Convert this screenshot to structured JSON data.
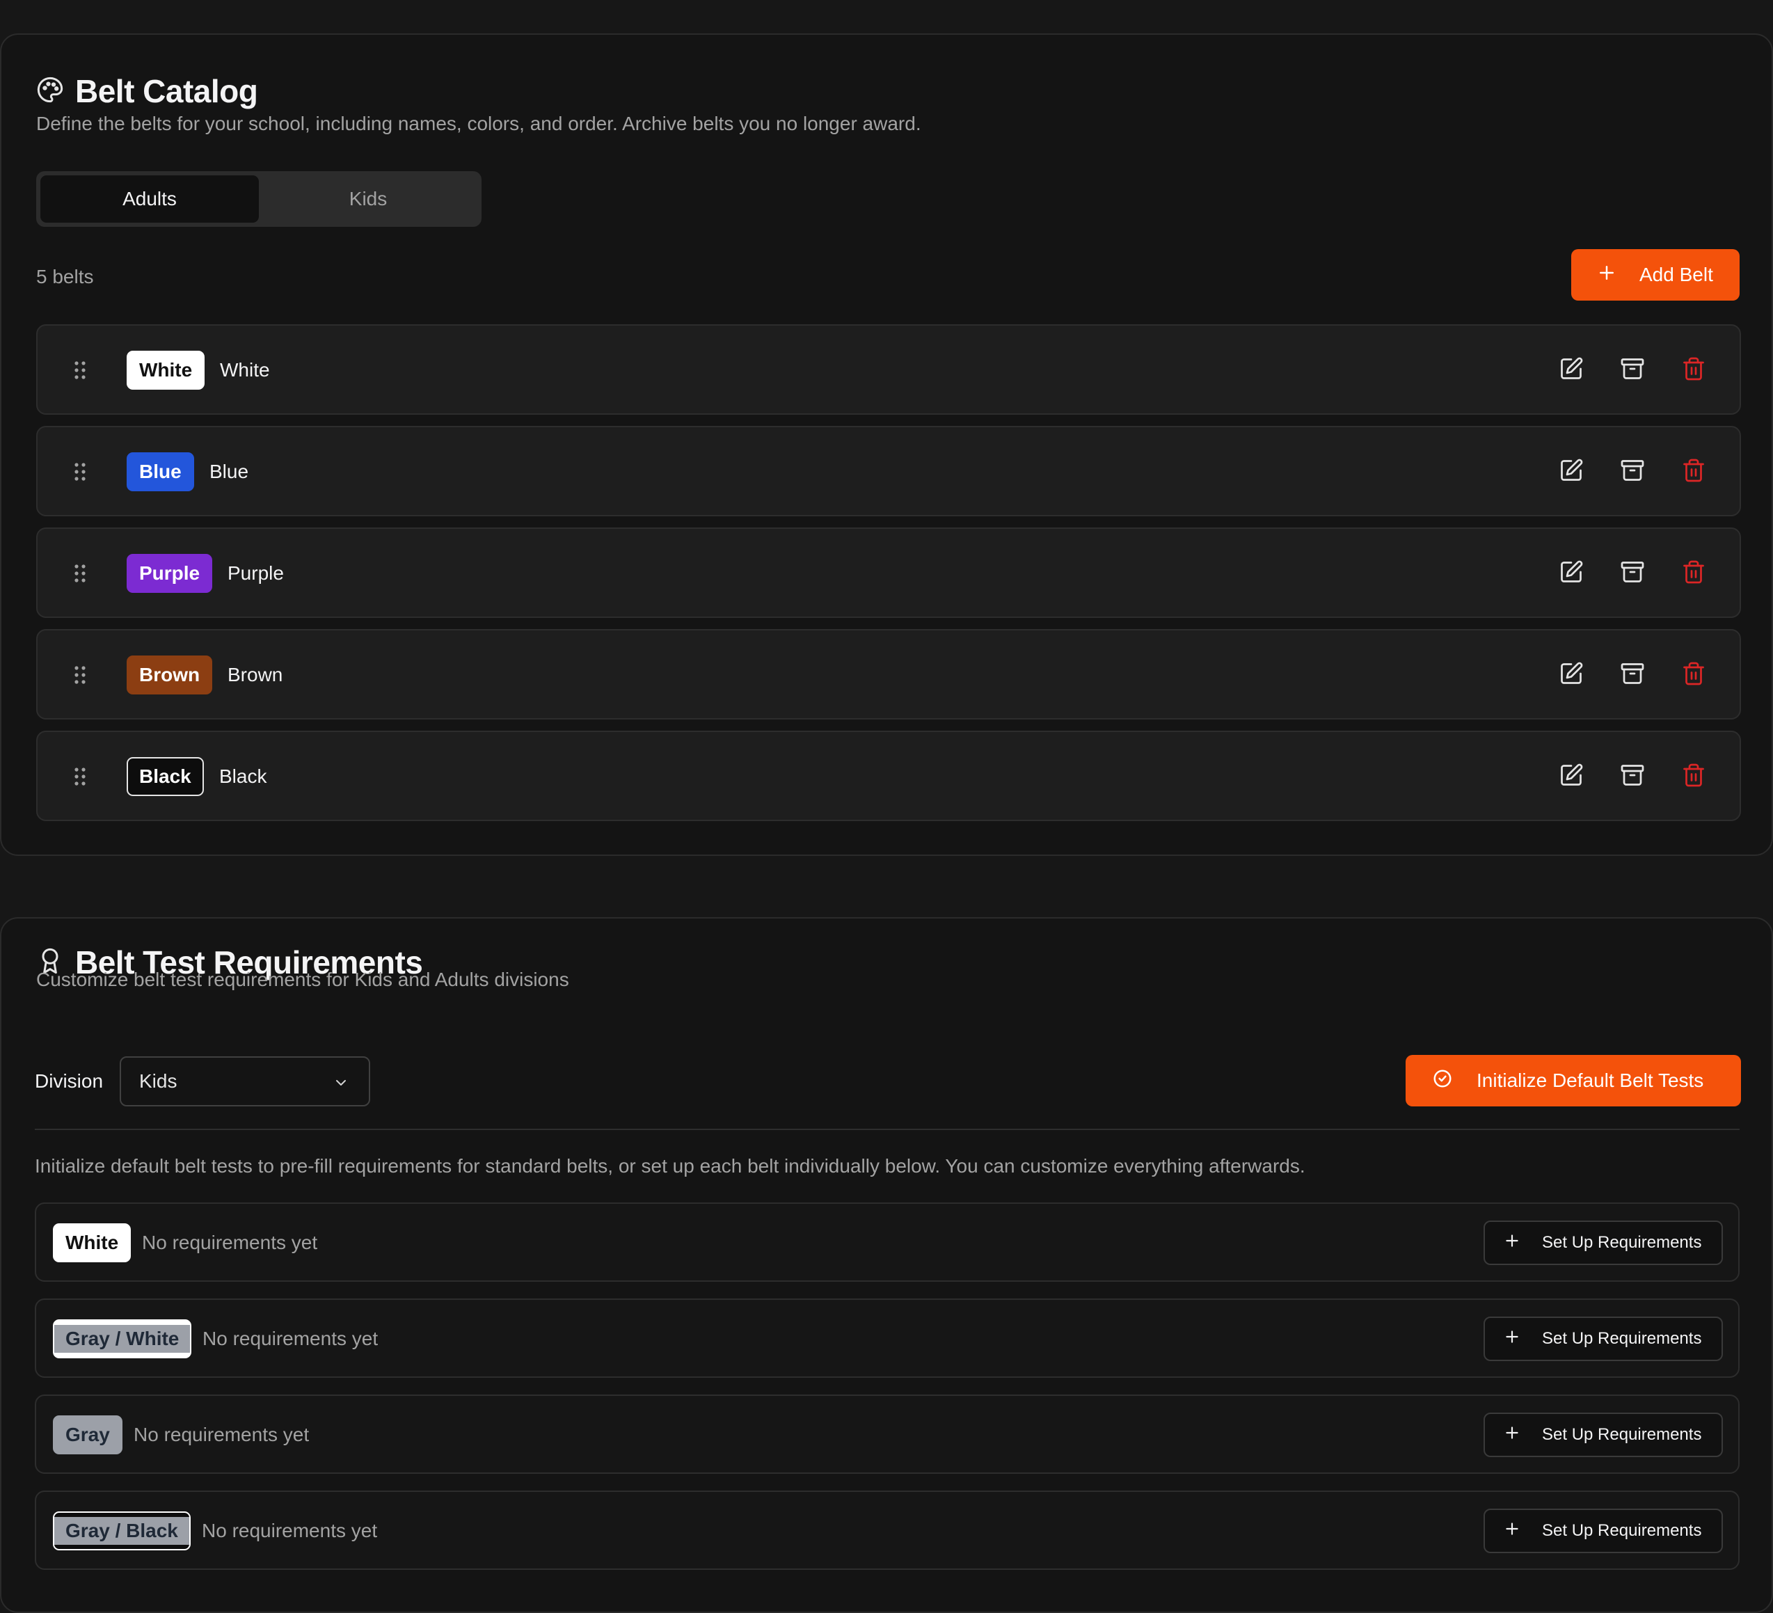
{
  "catalog": {
    "title": "Belt Catalog",
    "subtitle": "Define the belts for your school, including names, colors, and order. Archive belts you no longer award.",
    "tabs": [
      {
        "label": "Adults",
        "active": true
      },
      {
        "label": "Kids",
        "active": false
      }
    ],
    "count_label": "5 belts",
    "add_button": "Add Belt",
    "belts": [
      {
        "badge": "White",
        "name": "White",
        "bg": "#ffffff",
        "fg": "#111111",
        "border": "#ffffff"
      },
      {
        "badge": "Blue",
        "name": "Blue",
        "bg": "#2356db",
        "fg": "#ffffff",
        "border": "#2356db"
      },
      {
        "badge": "Purple",
        "name": "Purple",
        "bg": "#7c2bd2",
        "fg": "#ffffff",
        "border": "#7c2bd2"
      },
      {
        "badge": "Brown",
        "name": "Brown",
        "bg": "#8c3e12",
        "fg": "#ffffff",
        "border": "#8c3e12"
      },
      {
        "badge": "Black",
        "name": "Black",
        "bg": "#0d0d0d",
        "fg": "#ffffff",
        "border": "#e5e5e5"
      }
    ],
    "row_icons": [
      "drag-handle-icon",
      "edit-icon",
      "archive-icon",
      "trash-icon"
    ]
  },
  "tests": {
    "title": "Belt Test Requirements",
    "subtitle": "Customize belt test requirements for Kids and Adults divisions",
    "division_label": "Division",
    "division_value": "Kids",
    "init_button": "Initialize Default Belt Tests",
    "info": "Initialize default belt tests to pre-fill requirements for standard belts, or set up each belt individually below. You can customize everything afterwards.",
    "setup_button": "Set Up Requirements",
    "rows": [
      {
        "badge": "White",
        "status": "No requirements yet",
        "bg": "#ffffff",
        "fg": "#111111",
        "border": "#ffffff",
        "stripe": ""
      },
      {
        "badge": "Gray / White",
        "status": "No requirements yet",
        "bg": "#9ca0a8",
        "fg": "#1f2937",
        "border": "#ffffff",
        "stripe": "#ffffff"
      },
      {
        "badge": "Gray",
        "status": "No requirements yet",
        "bg": "#9ca0a8",
        "fg": "#1f2937",
        "border": "#9ca0a8",
        "stripe": ""
      },
      {
        "badge": "Gray / Black",
        "status": "No requirements yet",
        "bg": "#9ca0a8",
        "fg": "#1f2937",
        "border": "#ffffff",
        "stripe": "#0d0d0d"
      }
    ]
  },
  "colors": {
    "accent": "#f4520b",
    "danger": "#dc2626",
    "background": "#141414"
  }
}
